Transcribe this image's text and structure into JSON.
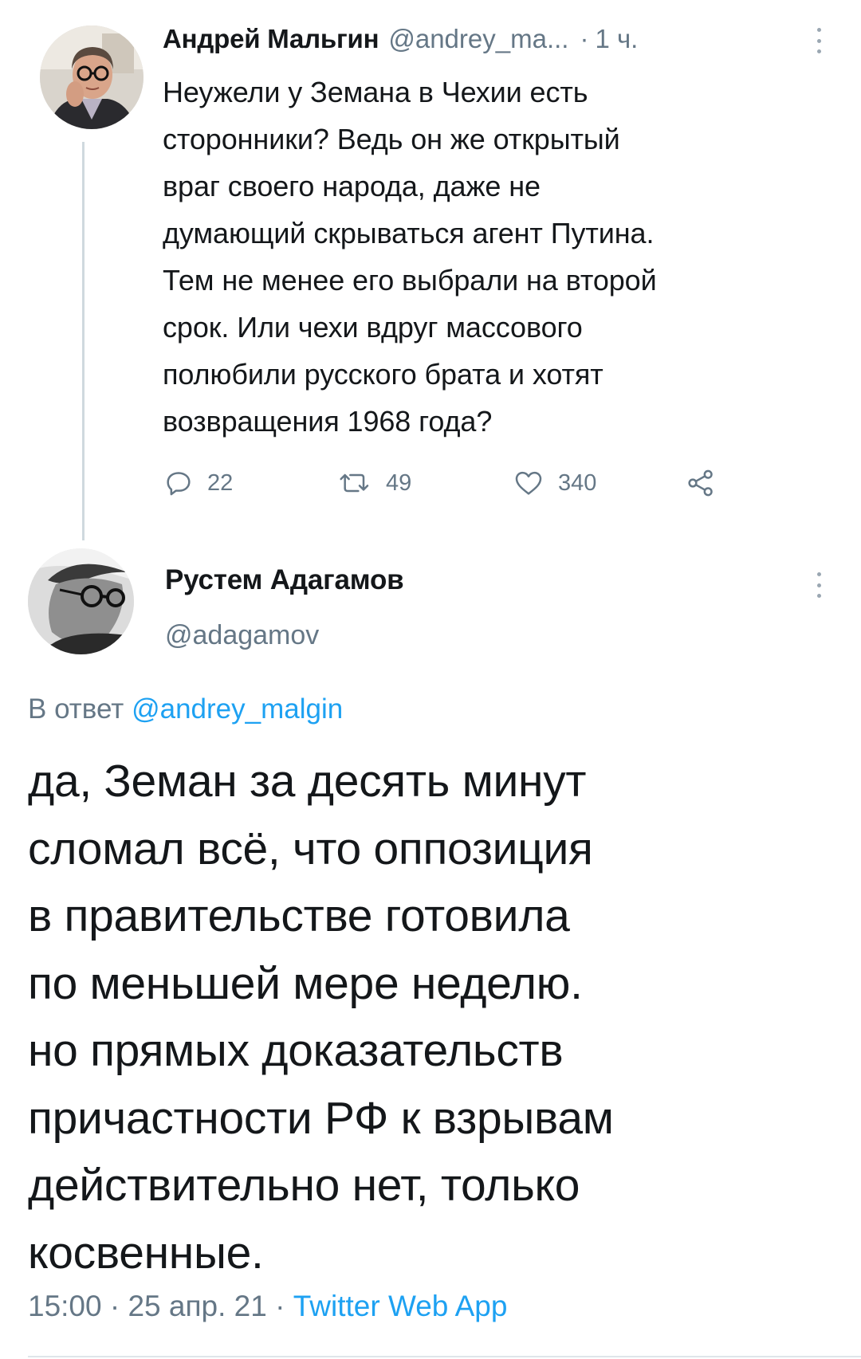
{
  "tweet1": {
    "author_name": "Андрей Мальгин",
    "author_handle": "@andrey_ma...",
    "separator": "·",
    "time": "1 ч.",
    "text": "Неужели у Земана в Чехии есть\nсторонники? Ведь он же открытый\nвраг своего народа, даже не\nдумающий скрываться агент Путина.\nТем не менее его выбрали на второй\nсрок. Или чехи вдруг массового\nполюбили русского брата и хотят\nвозвращения 1968 года?",
    "replies": "22",
    "retweets": "49",
    "likes": "340",
    "icons": {
      "reply": "reply-icon",
      "retweet": "retweet-icon",
      "like": "heart-icon",
      "share": "share-icon",
      "more": "more-vertical-icon"
    }
  },
  "tweet2": {
    "author_name": "Рустем Адагамов",
    "author_handle": "@adagamov",
    "reply_prefix": "В ответ",
    "reply_handle": "@andrey_malgin",
    "text": "да, Земан за десять минут\nсломал всё, что оппозиция\nв правительстве готовила\nпо меньшей мере неделю.\nно прямых доказательств\nпричастности РФ к взрывам\nдействительно нет, только\nкосвенные.",
    "time": "15:00",
    "separator": "·",
    "date": "25 апр. 21",
    "source": "Twitter Web App"
  },
  "colors": {
    "text": "#14171a",
    "secondary": "#657786",
    "link": "#1da1f2",
    "divider": "#cfd9de"
  }
}
